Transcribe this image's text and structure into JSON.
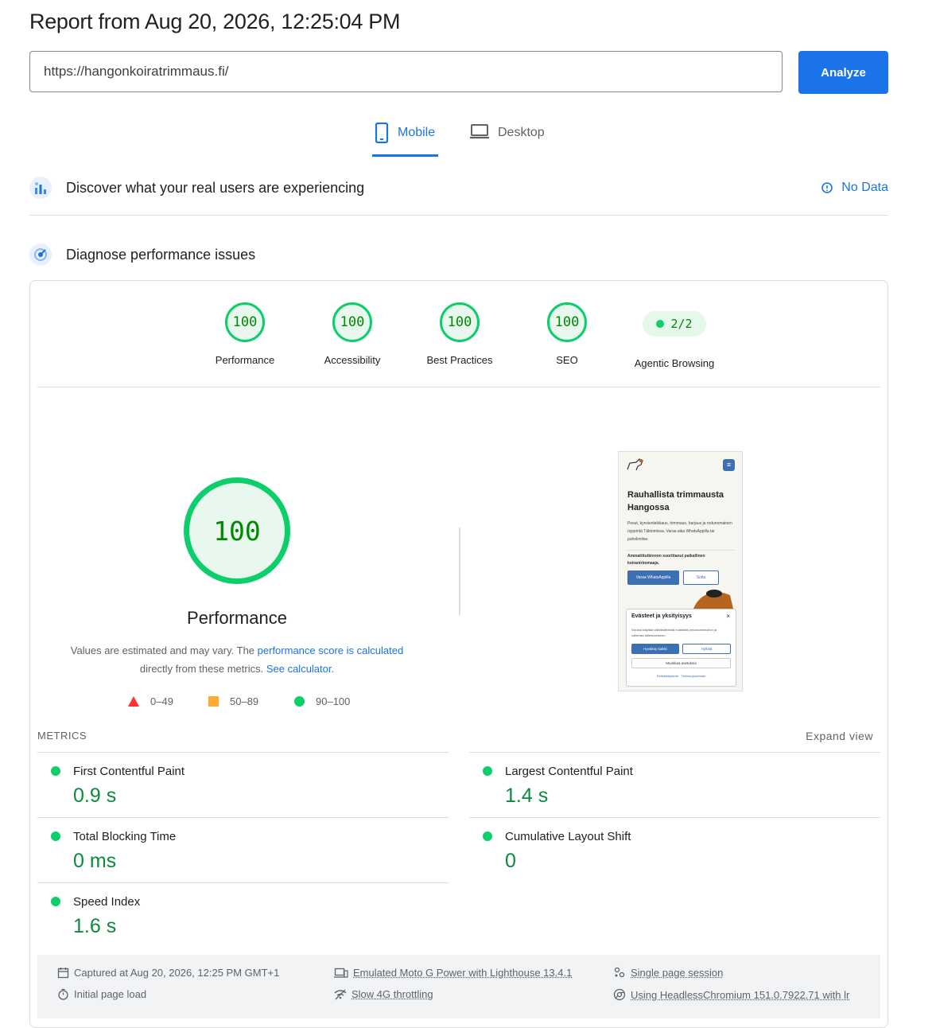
{
  "header": {
    "report_title": "Report from Aug 20, 2026, 12:25:04 PM",
    "url_value": "https://hangonkoiratrimmaus.fi/",
    "analyze_label": "Analyze"
  },
  "tabs": [
    {
      "label": "Mobile",
      "icon": "smartphone-icon",
      "active": true
    },
    {
      "label": "Desktop",
      "icon": "laptop-icon",
      "active": false
    }
  ],
  "field_data": {
    "title": "Discover what your real users are experiencing",
    "status": "No Data"
  },
  "lab": {
    "title": "Diagnose performance issues"
  },
  "categories": [
    {
      "label": "Performance",
      "score": "100"
    },
    {
      "label": "Accessibility",
      "score": "100"
    },
    {
      "label": "Best Practices",
      "score": "100"
    },
    {
      "label": "SEO",
      "score": "100"
    },
    {
      "label": "Agentic Browsing",
      "score": "2/2"
    }
  ],
  "performance": {
    "score": "100",
    "label": "Performance",
    "explain_prefix": "Values are estimated and may vary. The",
    "explain_link": "performance score is calculated",
    "explain_middle": "directly from these metrics.",
    "explain_calc": "See calculator."
  },
  "legend": [
    {
      "range": "0–49",
      "shape": "triangle",
      "color": "#ff3333"
    },
    {
      "range": "50–89",
      "shape": "square",
      "color": "#ffaa33"
    },
    {
      "range": "90–100",
      "shape": "circle",
      "color": "#0cce6b"
    }
  ],
  "screenshot": {
    "heading": "Rauhallista trimmausta Hangossa",
    "body": "Pesut, kynsienleikkaus, trimmaus, harjaus ja rodunomainen nyppintä Täktomissa. Varaa aika WhatsAppilla tai puhelimitse.",
    "subtext": "Ammattitutkinnon suorittanut paikallinen koirantrimmaaja.",
    "btn_primary": "Varaa WhatsAppilla",
    "btn_secondary": "Soita",
    "cookie_title": "Evästeet ja yksityisyys",
    "cookie_close": "×",
    "cookie_text": "Sivusto käyttää välttämättömiä evästeitä perustoimintoihin ja valinnasi tallentamiseen.",
    "cookie_accept": "Hyväksy kaikki",
    "cookie_reject": "Hylkää",
    "cookie_settings": "Muokkaa asetuksia",
    "cookie_links": "Evästekäytäntö   Tietosuojaseloste"
  },
  "metrics_header": "METRICS",
  "expand_label": "Expand view",
  "metrics": [
    {
      "name": "First Contentful Paint",
      "value": "0.9 s"
    },
    {
      "name": "Largest Contentful Paint",
      "value": "1.4 s"
    },
    {
      "name": "Total Blocking Time",
      "value": "0 ms"
    },
    {
      "name": "Cumulative Layout Shift",
      "value": "0"
    },
    {
      "name": "Speed Index",
      "value": "1.6 s"
    }
  ],
  "footer": {
    "captured": "Captured at Aug 20, 2026, 12:25 PM GMT+1",
    "initial_load": "Initial page load",
    "emulated": "Emulated Moto G Power with Lighthouse 13.4.1",
    "throttling": "Slow 4G throttling",
    "session": "Single page session",
    "browser": "Using HeadlessChromium 151.0.7922.71 with lr"
  }
}
